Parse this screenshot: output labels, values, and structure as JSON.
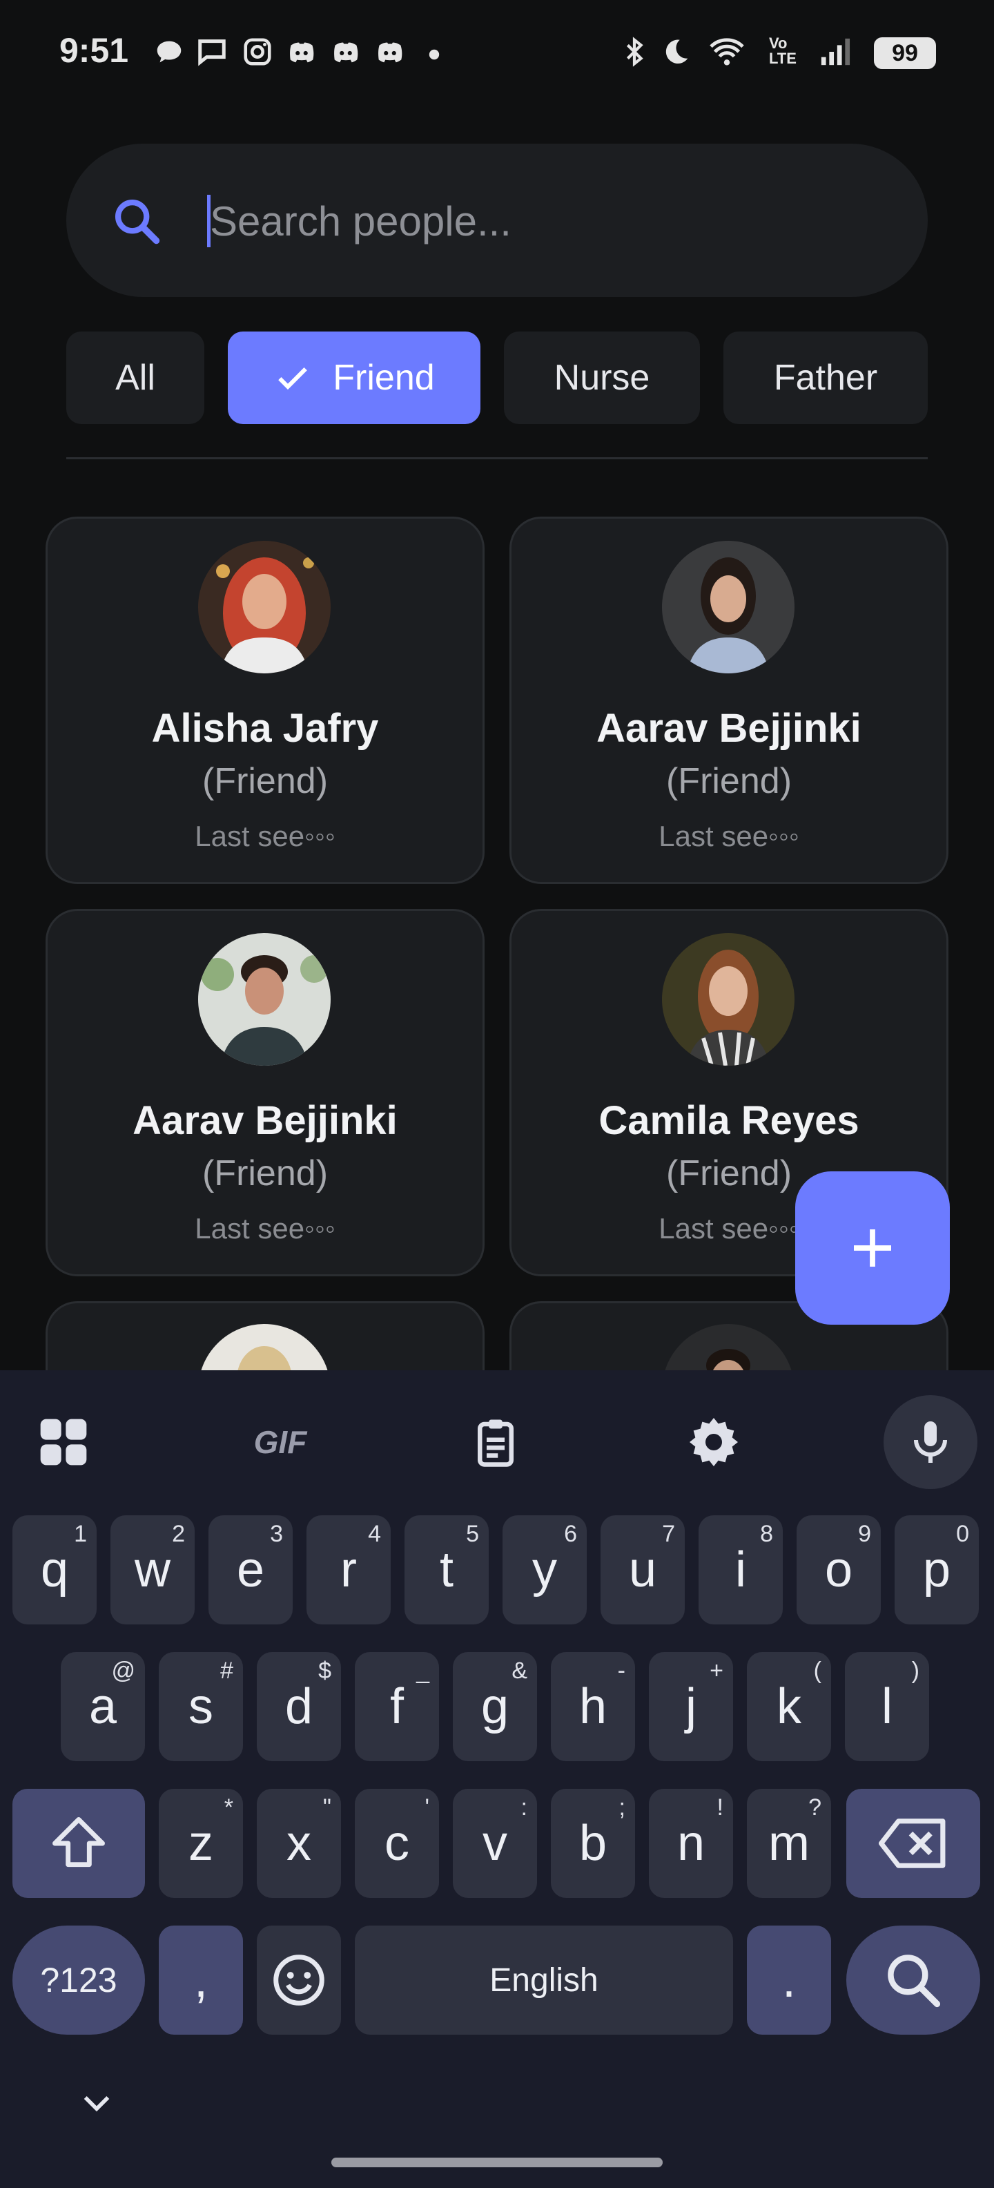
{
  "status_bar": {
    "time": "9:51",
    "battery": "99",
    "left_icons": [
      "chat-bubble-icon",
      "message-icon",
      "instagram-icon",
      "discord-icon",
      "discord-icon",
      "discord-icon",
      "dot-icon"
    ],
    "right_icons": [
      "bluetooth-icon",
      "moon-icon",
      "wifi-icon",
      "volte-icon",
      "signal-icon",
      "battery-icon"
    ]
  },
  "search": {
    "placeholder": "Search people...",
    "value": ""
  },
  "filters": [
    {
      "label": "All",
      "selected": false
    },
    {
      "label": "Friend",
      "selected": true
    },
    {
      "label": "Nurse",
      "selected": false
    },
    {
      "label": "Father",
      "selected": false
    }
  ],
  "people": [
    {
      "name": "Alisha Jafry",
      "relation": "(Friend)",
      "last_seen": "Last see◦◦◦"
    },
    {
      "name": "Aarav Bejjinki",
      "relation": "(Friend)",
      "last_seen": "Last see◦◦◦"
    },
    {
      "name": "Aarav Bejjinki",
      "relation": "(Friend)",
      "last_seen": "Last see◦◦◦"
    },
    {
      "name": "Camila Reyes",
      "relation": "(Friend)",
      "last_seen": "Last see◦◦◦"
    }
  ],
  "fab": {
    "icon": "plus-icon"
  },
  "keyboard": {
    "toolbar": {
      "gif_label": "GIF"
    },
    "row1": [
      {
        "k": "q",
        "h": "1"
      },
      {
        "k": "w",
        "h": "2"
      },
      {
        "k": "e",
        "h": "3"
      },
      {
        "k": "r",
        "h": "4"
      },
      {
        "k": "t",
        "h": "5"
      },
      {
        "k": "y",
        "h": "6"
      },
      {
        "k": "u",
        "h": "7"
      },
      {
        "k": "i",
        "h": "8"
      },
      {
        "k": "o",
        "h": "9"
      },
      {
        "k": "p",
        "h": "0"
      }
    ],
    "row2": [
      {
        "k": "a",
        "h": "@"
      },
      {
        "k": "s",
        "h": "#"
      },
      {
        "k": "d",
        "h": "$"
      },
      {
        "k": "f",
        "h": "_"
      },
      {
        "k": "g",
        "h": "&"
      },
      {
        "k": "h",
        "h": "-"
      },
      {
        "k": "j",
        "h": "+"
      },
      {
        "k": "k",
        "h": "("
      },
      {
        "k": "l",
        "h": ")"
      }
    ],
    "row3": [
      {
        "k": "z",
        "h": "*"
      },
      {
        "k": "x",
        "h": "\""
      },
      {
        "k": "c",
        "h": "'"
      },
      {
        "k": "v",
        "h": ":"
      },
      {
        "k": "b",
        "h": ";"
      },
      {
        "k": "n",
        "h": "!"
      },
      {
        "k": "m",
        "h": "?"
      }
    ],
    "symbols_label": "?123",
    "comma": ",",
    "space_label": "English",
    "period": "."
  }
}
